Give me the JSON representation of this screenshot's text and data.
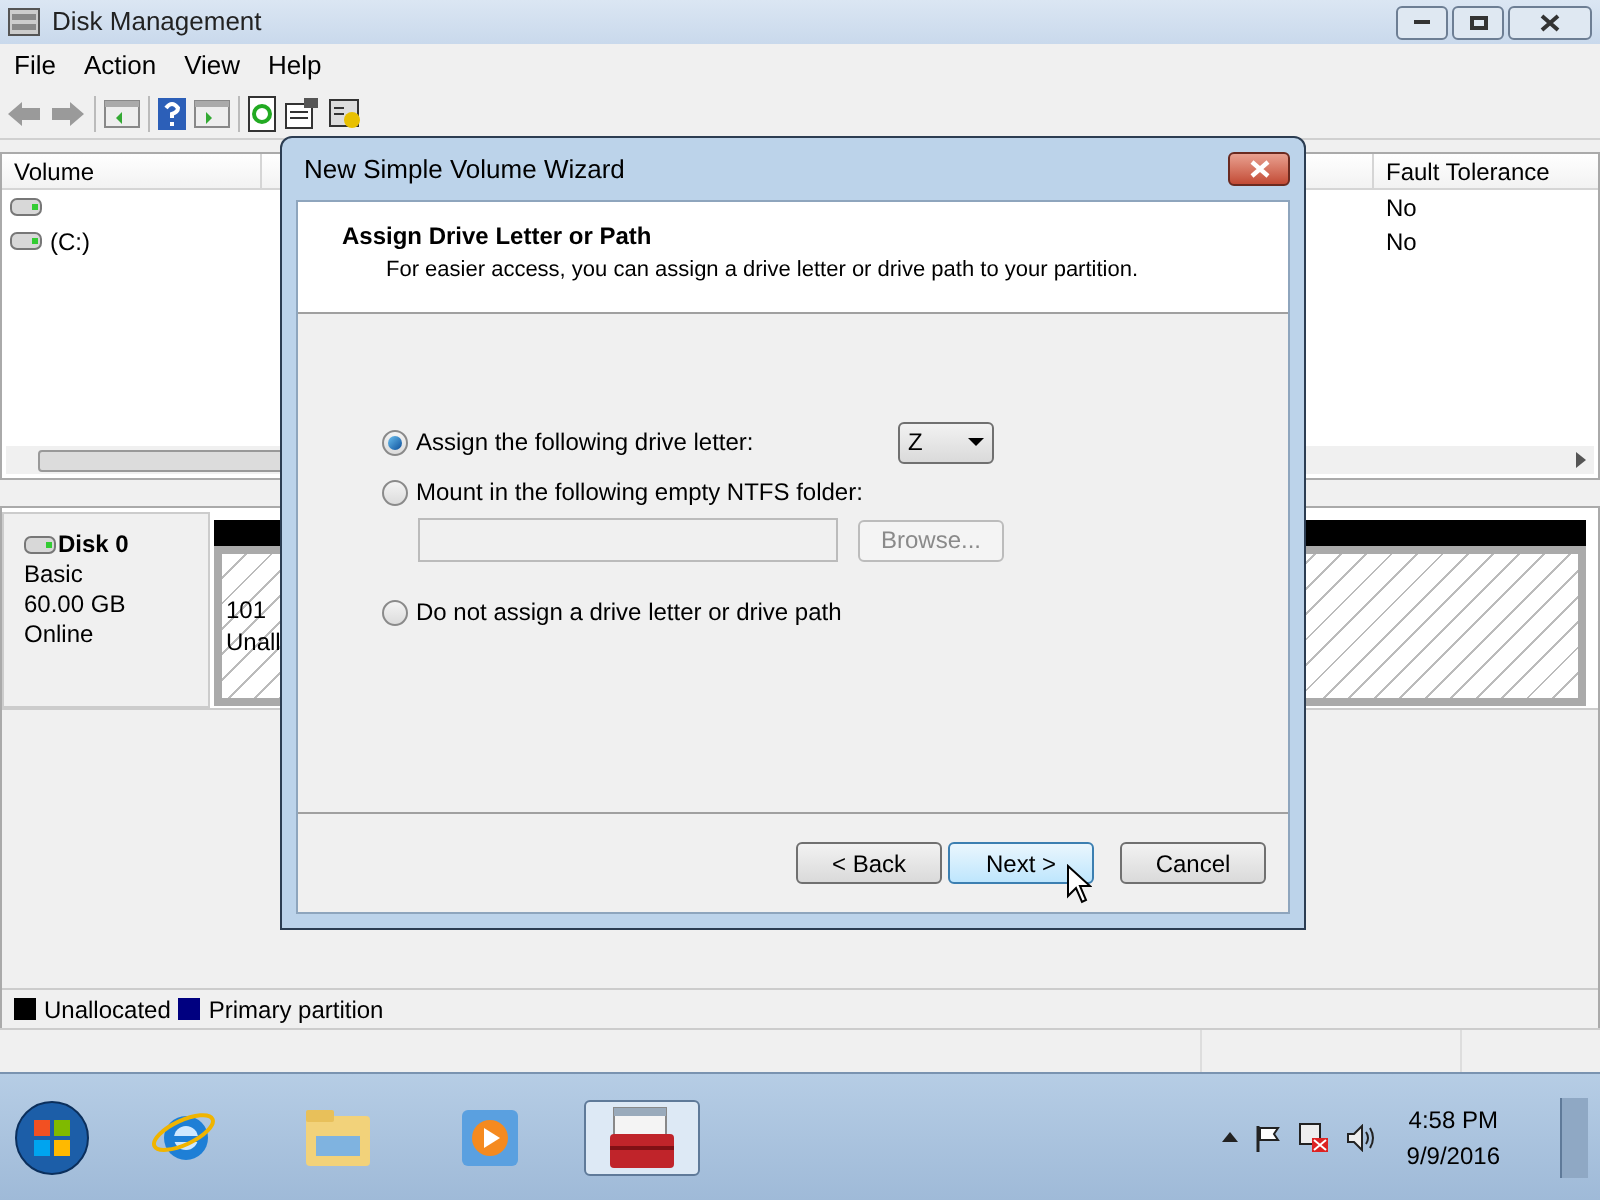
{
  "window": {
    "title": "Disk Management"
  },
  "menu": [
    "File",
    "Action",
    "View",
    "Help"
  ],
  "volume_list": {
    "columns": [
      "Volume",
      "Fault Tolerance"
    ],
    "rows": [
      {
        "fault_tolerance": "No"
      },
      {
        "volume": "(C:)",
        "fault_tolerance": "No"
      }
    ]
  },
  "disk": {
    "name": "Disk 0",
    "type": "Basic",
    "size": "60.00 GB",
    "status": "Online",
    "partition": {
      "size": "101",
      "label": "Unall"
    }
  },
  "legend": [
    {
      "label": "Unallocated",
      "color": "#000000"
    },
    {
      "label": "Primary partition",
      "color": "#000080"
    }
  ],
  "dialog": {
    "title": "New Simple Volume Wizard",
    "heading": "Assign Drive Letter or Path",
    "subheading": "For easier access, you can assign a drive letter or drive path to your partition.",
    "options": [
      {
        "label": "Assign the following drive letter:",
        "selected": true
      },
      {
        "label": "Mount in the following empty NTFS folder:",
        "selected": false
      },
      {
        "label": "Do not assign a drive letter or drive path",
        "selected": false
      }
    ],
    "drive_letter": "Z",
    "browse_button": {
      "label": "Browse...",
      "disabled": true
    },
    "buttons": [
      {
        "label": "< Back",
        "default": false
      },
      {
        "label": "Next >",
        "default": true
      },
      {
        "label": "Cancel",
        "default": false
      }
    ]
  },
  "taskbar": {
    "apps": [
      {
        "kind": "browser",
        "selected": false
      },
      {
        "kind": "folder",
        "selected": false
      },
      {
        "kind": "media",
        "selected": false
      },
      {
        "kind": "toolbox",
        "selected": true
      }
    ],
    "time": "4:58 PM",
    "date": "9/9/2016"
  }
}
